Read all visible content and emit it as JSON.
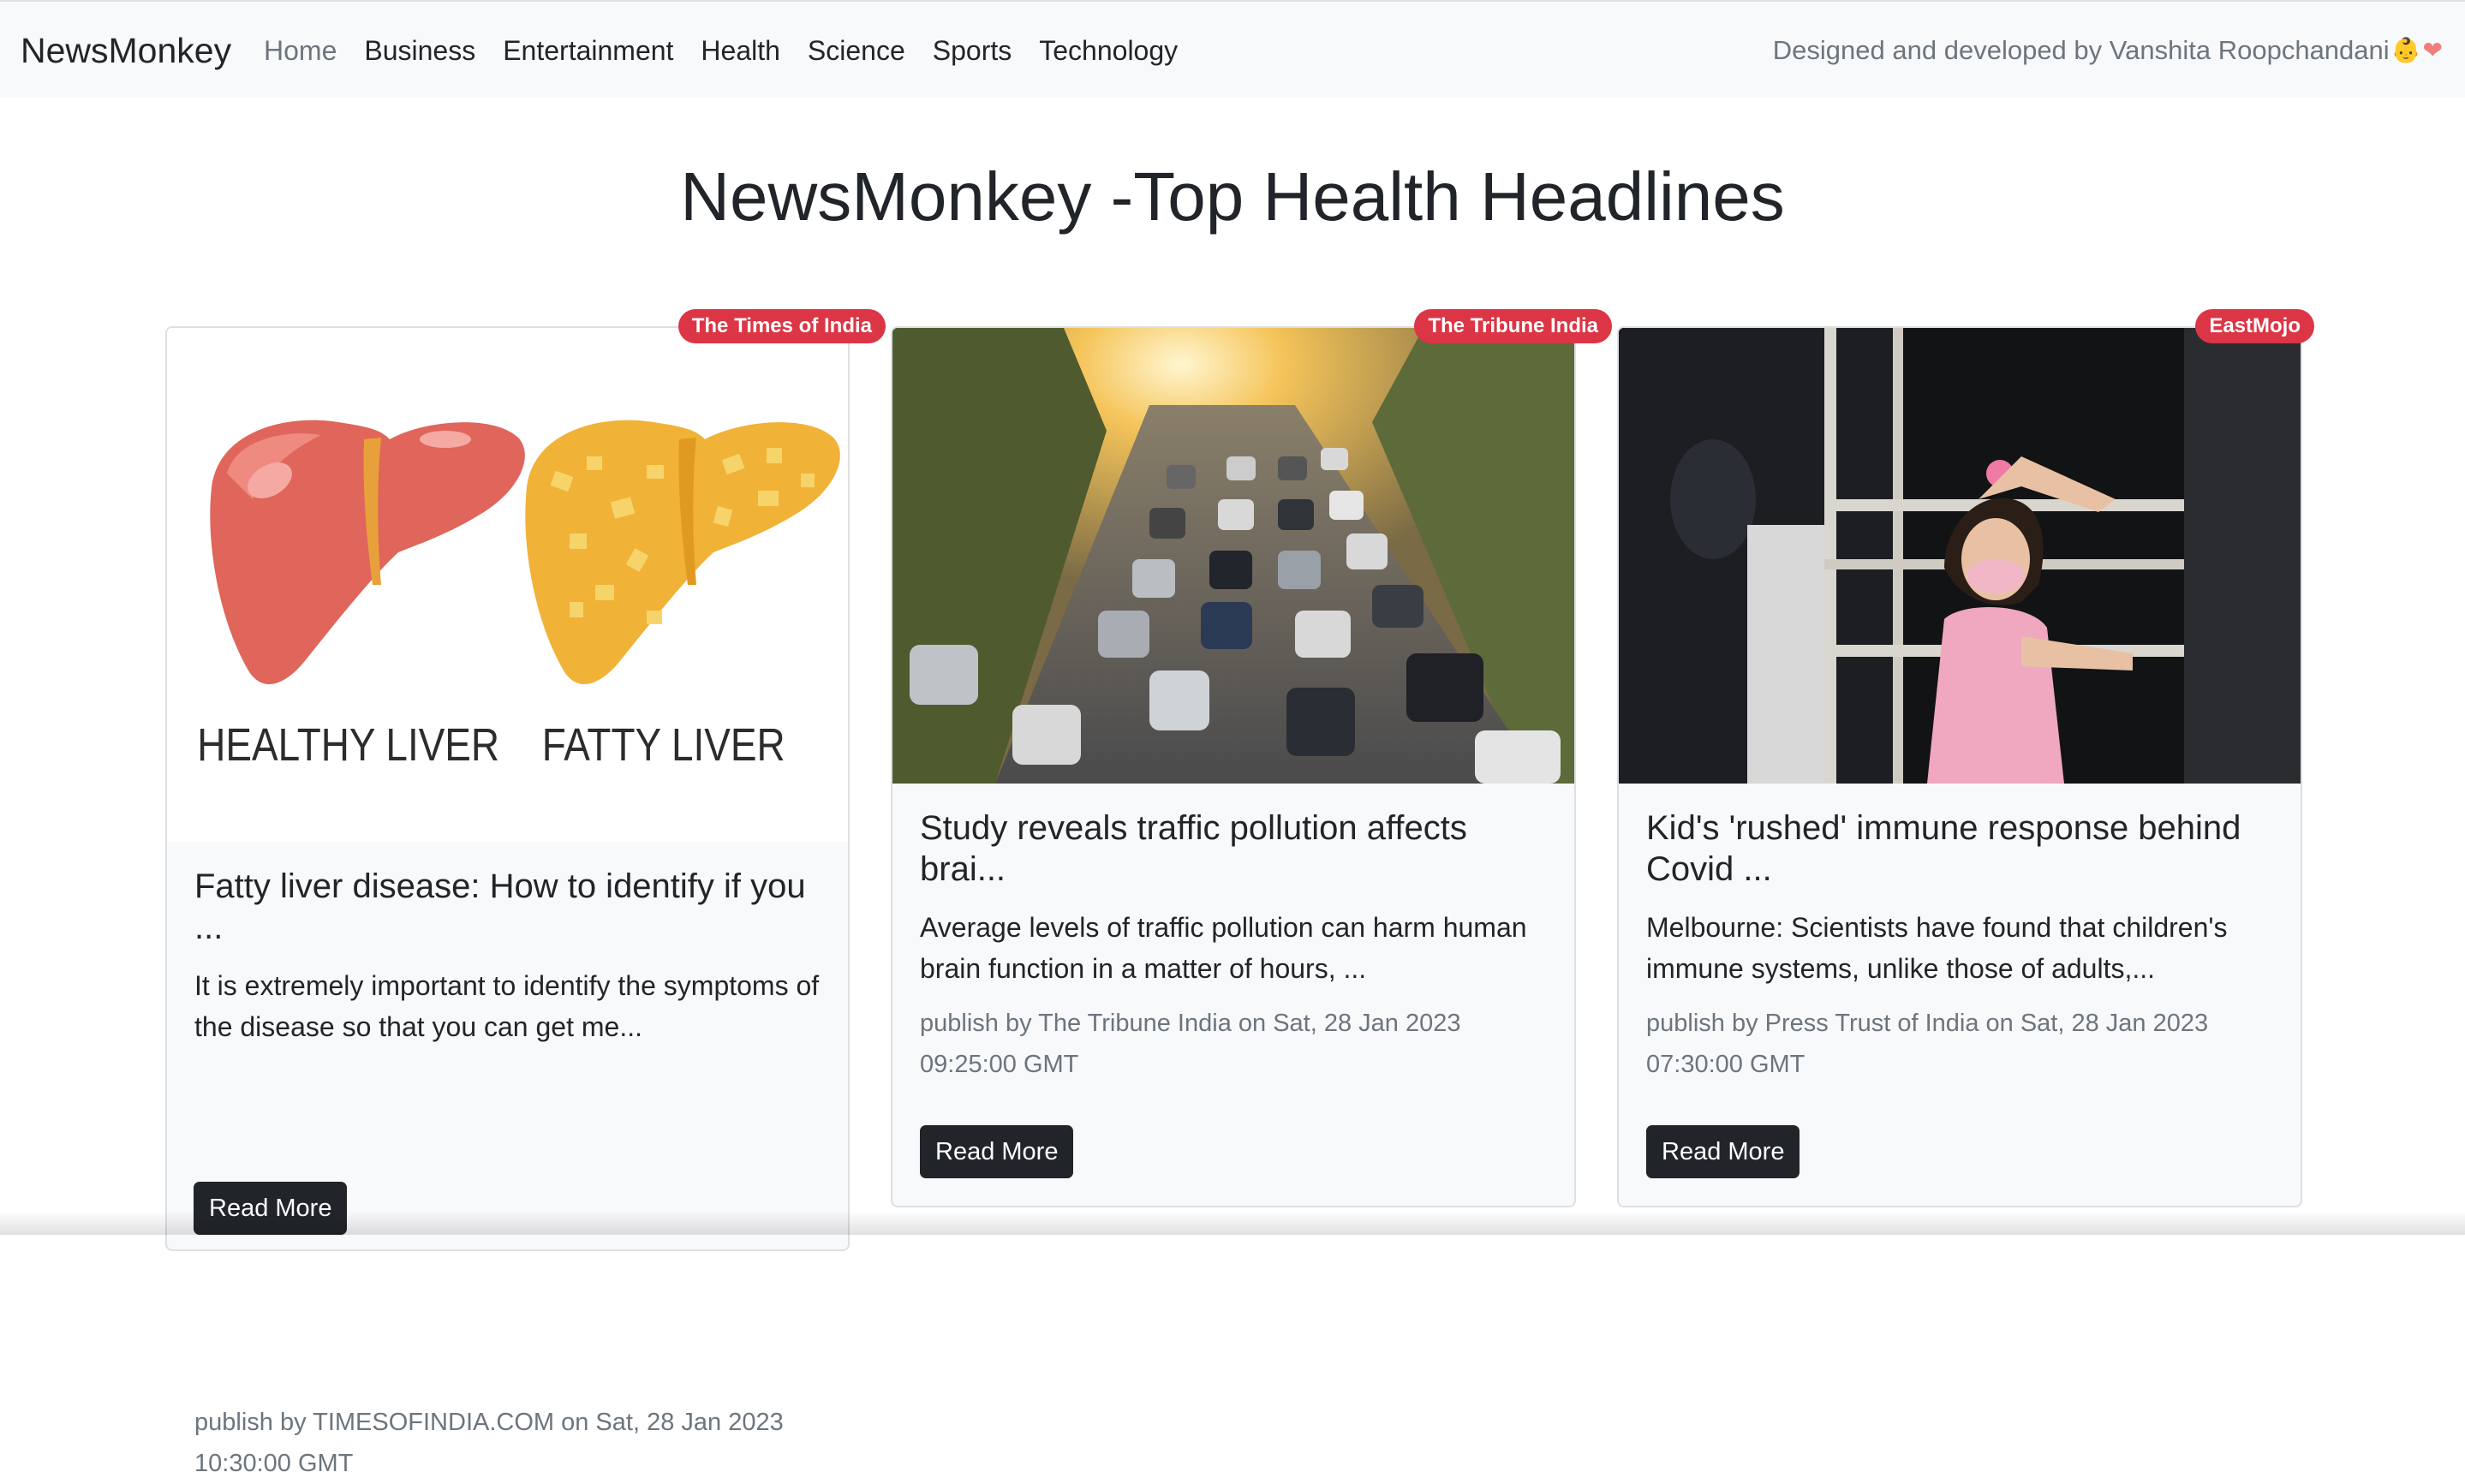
{
  "navbar": {
    "brand": "NewsMonkey",
    "links": [
      {
        "label": "Home",
        "active": true
      },
      {
        "label": "Business"
      },
      {
        "label": "Entertainment"
      },
      {
        "label": "Health"
      },
      {
        "label": "Science"
      },
      {
        "label": "Sports"
      },
      {
        "label": "Technology"
      }
    ],
    "credit": "Designed and developed by Vanshita Roopchandani",
    "credit_emoji_1": "👶",
    "credit_emoji_2": "❤"
  },
  "page_title": "NewsMonkey -Top Health Headlines",
  "articles": [
    {
      "source_badge": "The Times of India",
      "image": "healthy-vs-fatty-liver-illustration",
      "image_labels": [
        "HEALTHY LIVER",
        "FATTY LIVER"
      ],
      "title": "Fatty liver disease: How to identify if you ...",
      "description": "It is extremely important to identify the symptoms of the disease so that you can get me...",
      "meta": "publish by TIMESOFINDIA.COM on Sat, 28 Jan 2023 10:30:00 GMT",
      "button": "Read More"
    },
    {
      "source_badge": "The Tribune India",
      "image": "traffic-jam-photo",
      "title": "Study reveals traffic pollution affects brai...",
      "description": "Average levels of traffic pollution can harm human brain function in a matter of hours, ...",
      "meta": "publish by The Tribune India on Sat, 28 Jan 2023 09:25:00 GMT",
      "button": "Read More"
    },
    {
      "source_badge": "EastMojo",
      "image": "masked-child-at-window-photo",
      "title": "Kid's 'rushed' immune response behind Covid ...",
      "description": "Melbourne: Scientists have found that children's immune systems, unlike those of adults,...",
      "meta": "publish by Press Trust of India on Sat, 28 Jan 2023 07:30:00 GMT",
      "button": "Read More"
    }
  ],
  "colors": {
    "navbar_bg": "#f8f9fa",
    "badge": "#dc3545",
    "button": "#212529",
    "muted": "#6c757d"
  }
}
